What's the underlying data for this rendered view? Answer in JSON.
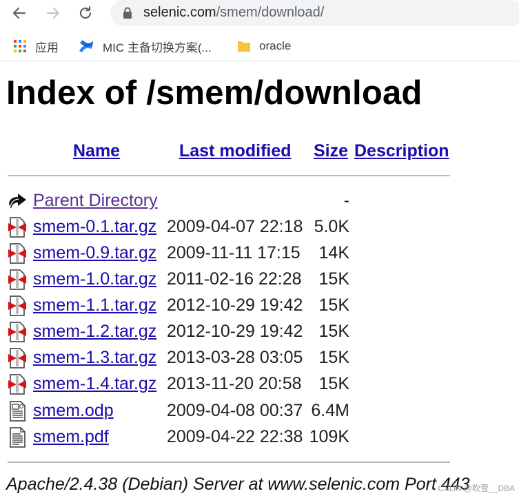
{
  "browser": {
    "url_host": "selenic.com",
    "url_path": "/smem/download/",
    "bookmarks": [
      {
        "label": "应用",
        "icon": "apps-grid-icon"
      },
      {
        "label": "MIC 主备切换方案(...",
        "icon": "confluence-icon"
      },
      {
        "label": "oracle",
        "icon": "folder-icon"
      }
    ]
  },
  "page": {
    "title": "Index of /smem/download",
    "columns": {
      "name": "Name",
      "last_modified": "Last modified",
      "size": "Size",
      "description": "Description"
    },
    "parent": {
      "name": "Parent Directory",
      "size": "-"
    },
    "files": [
      {
        "name": "smem-0.1.tar.gz",
        "modified": "2009-04-07 22:18",
        "size": "5.0K",
        "icon": "compressed-file-icon"
      },
      {
        "name": "smem-0.9.tar.gz",
        "modified": "2009-11-11 17:15",
        "size": "14K",
        "icon": "compressed-file-icon"
      },
      {
        "name": "smem-1.0.tar.gz",
        "modified": "2011-02-16 22:28",
        "size": "15K",
        "icon": "compressed-file-icon"
      },
      {
        "name": "smem-1.1.tar.gz",
        "modified": "2012-10-29 19:42",
        "size": "15K",
        "icon": "compressed-file-icon"
      },
      {
        "name": "smem-1.2.tar.gz",
        "modified": "2012-10-29 19:42",
        "size": "15K",
        "icon": "compressed-file-icon"
      },
      {
        "name": "smem-1.3.tar.gz",
        "modified": "2013-03-28 03:05",
        "size": "15K",
        "icon": "compressed-file-icon"
      },
      {
        "name": "smem-1.4.tar.gz",
        "modified": "2013-11-20 20:58",
        "size": "15K",
        "icon": "compressed-file-icon"
      },
      {
        "name": "smem.odp",
        "modified": "2009-04-08 00:37",
        "size": "6.4M",
        "icon": "layout-file-icon"
      },
      {
        "name": "smem.pdf",
        "modified": "2009-04-22 22:38",
        "size": "109K",
        "icon": "text-file-icon"
      }
    ],
    "footer": "Apache/2.4.38 (Debian) Server at www.selenic.com Port 443",
    "watermark": "CSDN @吹雪__DBA"
  }
}
